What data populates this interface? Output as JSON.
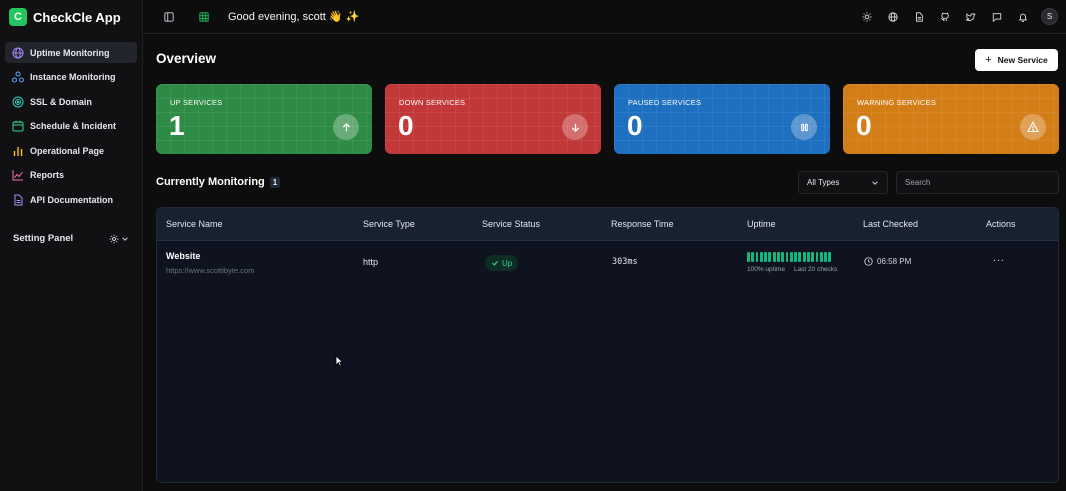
{
  "brand": {
    "logo_letter": "C",
    "name": "CheckCle App",
    "accent": "#22c55e"
  },
  "sidebar": {
    "items": [
      {
        "label": "Uptime Monitoring",
        "icon": "globe-icon",
        "active": true
      },
      {
        "label": "Instance Monitoring",
        "icon": "network-icon"
      },
      {
        "label": "SSL & Domain",
        "icon": "ssl-icon"
      },
      {
        "label": "Schedule & Incident",
        "icon": "calendar-icon"
      },
      {
        "label": "Operational Page",
        "icon": "bar-chart-icon"
      },
      {
        "label": "Reports",
        "icon": "line-chart-icon"
      },
      {
        "label": "API Documentation",
        "icon": "document-icon"
      }
    ],
    "setting_panel": {
      "label": "Setting Panel",
      "icon": "gear-icon"
    }
  },
  "topbar": {
    "greeting": "Good evening, scott 👋 ✨",
    "icons": [
      "sidebar-toggle-icon",
      "grid-icon",
      "sun-icon",
      "globe-icon",
      "document-icon",
      "github-icon",
      "twitter-icon",
      "chat-icon",
      "bell-icon"
    ],
    "avatar_letter": "S"
  },
  "overview": {
    "title": "Overview",
    "new_service_label": "New Service",
    "cards": [
      {
        "label": "UP SERVICES",
        "value": "1",
        "color": "#2e8b45",
        "icon": "arrow-up-icon"
      },
      {
        "label": "DOWN SERVICES",
        "value": "0",
        "color": "#c23838",
        "icon": "arrow-down-icon"
      },
      {
        "label": "PAUSED SERVICES",
        "value": "0",
        "color": "#1e6fbf",
        "icon": "pause-icon"
      },
      {
        "label": "WARNING SERVICES",
        "value": "0",
        "color": "#d37d17",
        "icon": "warning-icon"
      }
    ]
  },
  "monitoring": {
    "title": "Currently Monitoring",
    "count": "1",
    "type_filter": "All Types",
    "search_placeholder": "Search",
    "columns": [
      "Service Name",
      "Service Type",
      "Service Status",
      "Response Time",
      "Uptime",
      "Last Checked",
      "Actions"
    ],
    "rows": [
      {
        "name": "Website",
        "url": "https://www.scottibyte.com",
        "type": "http",
        "status": "Up",
        "response_time": "303ms",
        "uptime_bars": 20,
        "uptime_percent_label": "100% uptime",
        "uptime_checks_label": "Last 20 checks",
        "last_checked": "06:58 PM",
        "actions": "···"
      }
    ]
  }
}
